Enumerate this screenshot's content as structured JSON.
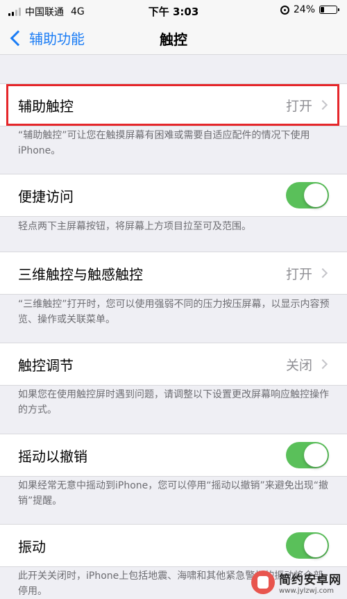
{
  "status_bar": {
    "carrier": "中国联通",
    "network": "4G",
    "time": "下午 3:03",
    "battery": "24%",
    "battery_level": 0.24
  },
  "nav": {
    "back_label": "辅助功能",
    "title": "触控"
  },
  "rows": [
    {
      "label": "辅助触控",
      "value": "打开",
      "desc": "“辅助触控”可让您在触摸屏幕有困难或需要自适应配件的情况下使用iPhone。"
    },
    {
      "label": "便捷访问",
      "toggle_on": true,
      "desc": "轻点两下主屏幕按钮，将屏幕上方项目拉至可及范围。"
    },
    {
      "label": "三维触控与触感触控",
      "value": "打开",
      "desc": "“三维触控”打开时，您可以使用强弱不同的压力按压屏幕，以显示内容预览、操作或关联菜单。"
    },
    {
      "label": "触控调节",
      "value": "关闭",
      "desc": "如果您在使用触控屏时遇到问题，请调整以下设置更改屏幕响应触控操作的方式。"
    },
    {
      "label": "摇动以撤销",
      "toggle_on": true,
      "desc": "如果经常无意中摇动到iPhone，您可以停用“摇动以撤销”来避免出现“撤销”提醒。"
    },
    {
      "label": "振动",
      "toggle_on": true,
      "desc": "此开关关闭时，iPhone上包括地震、海啸和其他紧急警报的振动将全部停用。"
    }
  ],
  "colors": {
    "accent": "#1a7cf5",
    "toggle_on": "#5ac05a",
    "highlight": "#e5262a"
  },
  "watermark": {
    "name": "简约安卓网",
    "url": "www.jylzwj.com"
  }
}
